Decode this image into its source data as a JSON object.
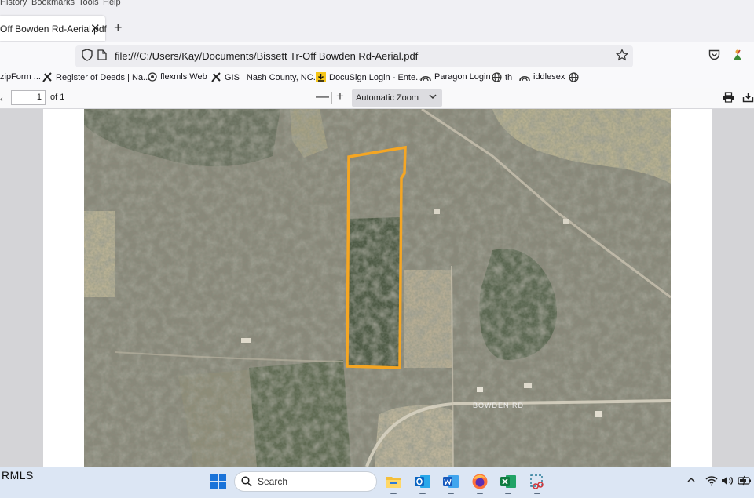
{
  "menu": [
    "History",
    "Bookmarks",
    "Tools",
    "Help"
  ],
  "tab": {
    "title": "Off Bowden Rd-Aerial.pdf",
    "close": "✕",
    "new_tab": "+"
  },
  "address": {
    "url": "file:///C:/Users/Kay/Documents/Bissett Tr-Off Bowden Rd-Aerial.pdf"
  },
  "bookmarks": [
    {
      "label": "zipForm ...",
      "icon": "zipform-icon"
    },
    {
      "label": "Register of Deeds | Na...",
      "icon": "register-of-deeds-icon"
    },
    {
      "label": "flexmls Web",
      "icon": "flexmls-icon"
    },
    {
      "label": "GIS | Nash County, NC...",
      "icon": "gis-icon"
    },
    {
      "label": "DocuSign Login - Ente...",
      "icon": "docusign-icon"
    },
    {
      "label": "Paragon Login",
      "icon": "paragon-icon"
    },
    {
      "label": "th",
      "icon": "globe-icon"
    },
    {
      "label": "iddlesex",
      "icon": "paragon-icon"
    },
    {
      "label": "",
      "icon": "globe-icon"
    }
  ],
  "pdf_toolbar": {
    "page_number": "1",
    "page_count": "of 1",
    "zoom_out": "—",
    "zoom_in": "+",
    "zoom": "Automatic Zoom"
  },
  "map": {
    "road_label": "BOWDEN RD",
    "parcel_outline_color": "#f5a623"
  },
  "taskbar": {
    "watermark": "RMLS",
    "search_placeholder": "Search",
    "apps": [
      "file-explorer-icon",
      "outlook-icon",
      "word-icon",
      "firefox-icon",
      "excel-icon",
      "snipping-tool-icon"
    ]
  },
  "colors": {
    "accent": "#0060df",
    "taskbar": "#dce6f4",
    "chrome": "#f0f0f4"
  }
}
